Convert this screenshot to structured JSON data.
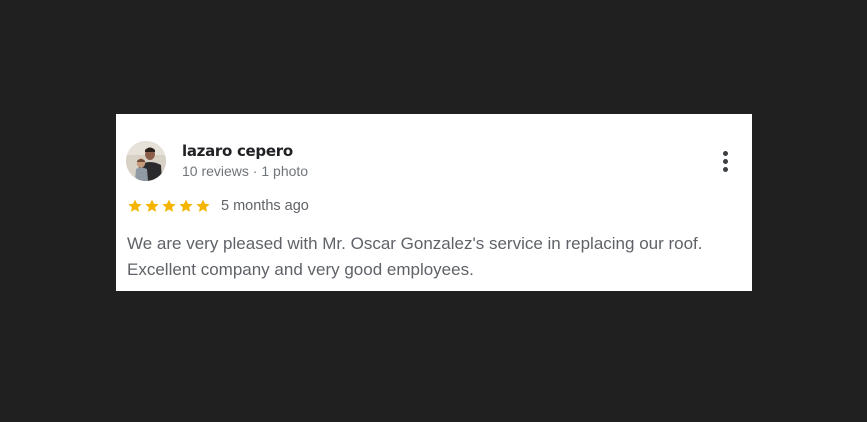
{
  "review": {
    "author": {
      "name": "lazaro cepero",
      "meta": "10 reviews · 1 photo",
      "avatar": "profile-photo"
    },
    "rating": {
      "stars": 5,
      "max_stars": 5,
      "star_color": "#f4b400"
    },
    "time": "5 months ago",
    "text": "We are very pleased with Mr. Oscar Gonzalez's service in replacing our roof. Excellent company and very good employees.",
    "menu_icon": "more-vert-icon"
  },
  "colors": {
    "page_background": "#202020",
    "card_background": "#ffffff",
    "name_text": "#202124",
    "secondary_text": "#70757a",
    "body_text": "#5f6368"
  }
}
